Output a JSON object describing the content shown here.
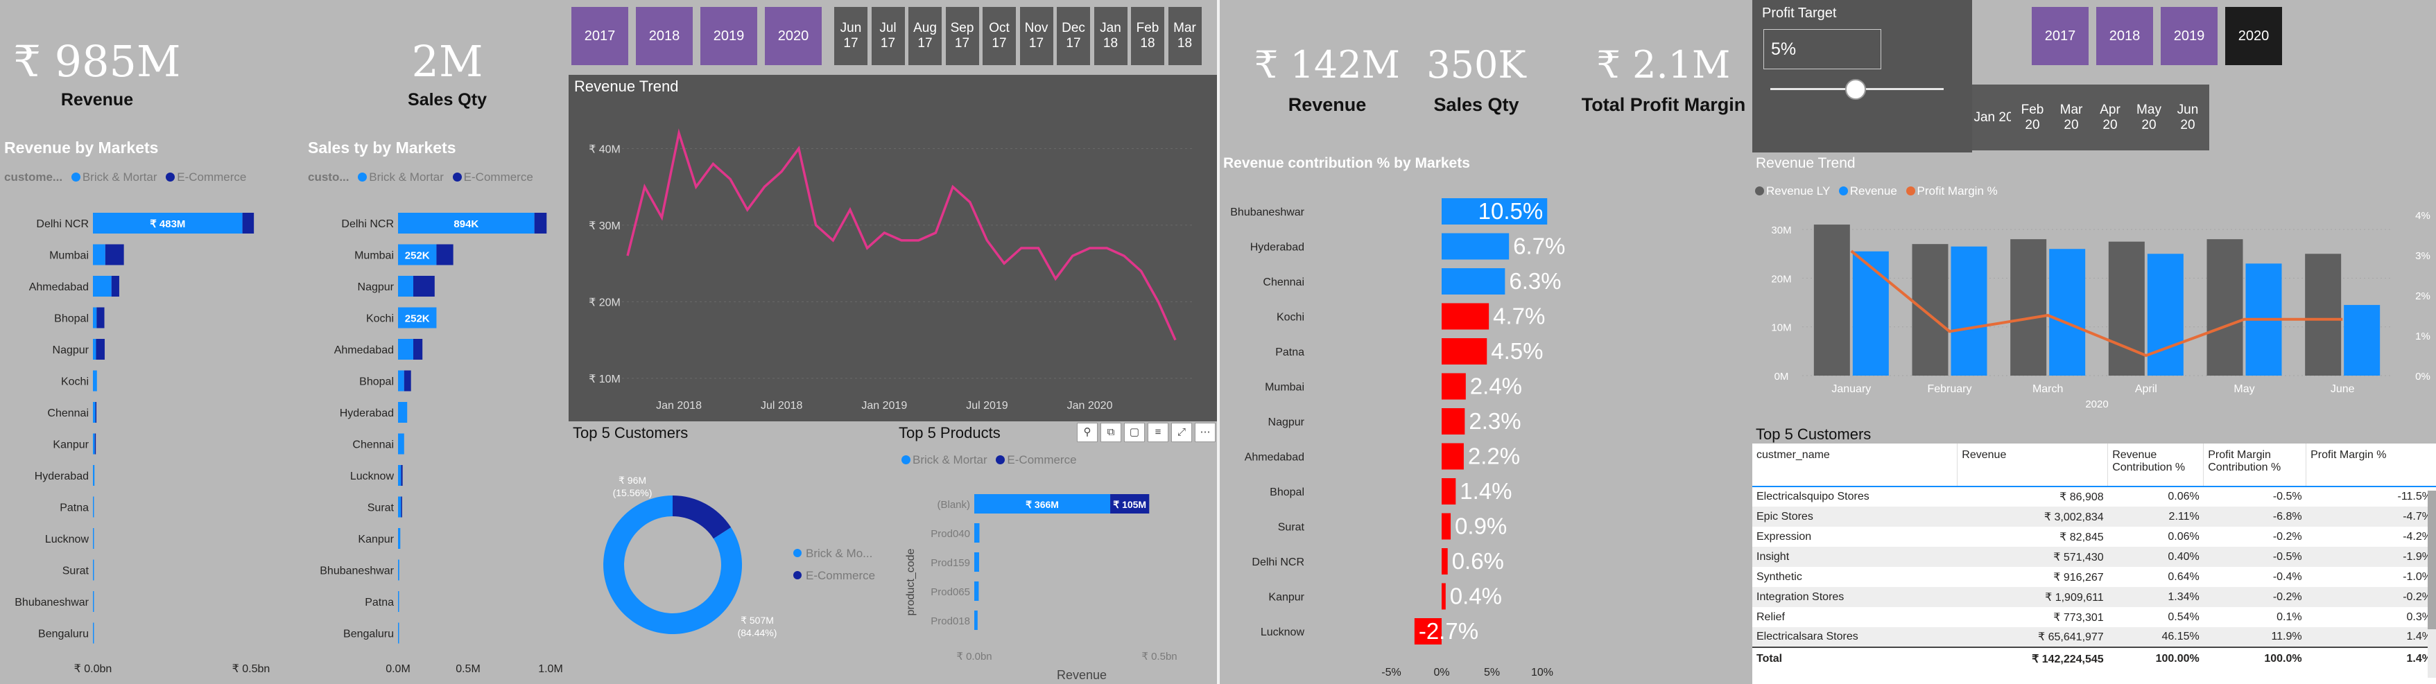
{
  "left": {
    "kpis": [
      {
        "value": "₹ 985M",
        "label": "Revenue"
      },
      {
        "value": "2M",
        "label": "Sales Qty"
      }
    ],
    "revenue_by_markets": {
      "title": "Revenue by Markets",
      "legend_prefix": "custome...",
      "legend_brick": "Brick & Mortar",
      "legend_ecom": "E-Commerce",
      "axis_ticks": [
        "₹ 0.0bn",
        "₹ 0.5bn"
      ]
    },
    "sales_by_markets": {
      "title": "Sales ty by Markets",
      "legend_prefix": "custo...",
      "legend_brick": "Brick & Mortar",
      "legend_ecom": "E-Commerce",
      "axis_ticks": [
        "0.0M",
        "0.5M",
        "1.0M"
      ]
    },
    "years": [
      "2017",
      "2018",
      "2019",
      "2020"
    ],
    "months": [
      "Jun\n17",
      "Jul\n17",
      "Aug\n17",
      "Sep\n17",
      "Oct\n17",
      "Nov\n17",
      "Dec\n17",
      "Jan\n18",
      "Feb\n18",
      "Mar\n18"
    ],
    "revenue_trend_title": "Revenue Trend",
    "top5_customers_title": "Top 5 Customers",
    "top5_products_title": "Top 5 Products",
    "donut": {
      "label_small_value": "₹ 96M",
      "label_small_pct": "(15.56%)",
      "label_big_value": "₹ 507M",
      "label_big_pct": "(84.44%)",
      "legend_brick": "Brick & Mo...",
      "legend_ecom": "E-Commerce"
    },
    "products": {
      "legend_brick": "Brick & Mortar",
      "legend_ecom": "E-Commerce",
      "y_axis_label": "product_code",
      "x_axis_label": "Revenue",
      "x_ticks": [
        "₹ 0.0bn",
        "₹ 0.5bn"
      ]
    }
  },
  "right": {
    "kpis": [
      {
        "value": "₹ 142M",
        "label": "Revenue"
      },
      {
        "value": "350K",
        "label": "Sales Qty"
      },
      {
        "value": "₹ 2.1M",
        "label": "Total Profit Margin"
      }
    ],
    "contrib_title": "Revenue contribution % by Markets",
    "profit_target": {
      "label": "Profit Target",
      "value": "5%",
      "slider_fraction": 0.49
    },
    "years": [
      "2017",
      "2018",
      "2019",
      "2020"
    ],
    "selected_year": "2020",
    "months": [
      "Jan 20",
      "Feb\n20",
      "Mar\n20",
      "Apr\n20",
      "May\n20",
      "Jun\n20"
    ],
    "trend_title": "Revenue Trend",
    "trend_legend": [
      "Revenue LY",
      "Revenue",
      "Profit Margin %"
    ],
    "top5_title": "Top 5 Customers",
    "table": {
      "headers": [
        "custmer_name",
        "Revenue",
        "Revenue Contribution %",
        "Profit Margin Contribution %",
        "Profit Margin %"
      ],
      "rows": [
        [
          "Electricalsquipo Stores",
          "₹ 86,908",
          "0.06%",
          "-0.5%",
          "-11.5%"
        ],
        [
          "Epic Stores",
          "₹ 3,002,834",
          "2.11%",
          "-6.8%",
          "-4.7%"
        ],
        [
          "Expression",
          "₹ 82,845",
          "0.06%",
          "-0.2%",
          "-4.2%"
        ],
        [
          "Insight",
          "₹ 571,430",
          "0.40%",
          "-0.5%",
          "-1.9%"
        ],
        [
          "Synthetic",
          "₹ 916,267",
          "0.64%",
          "-0.4%",
          "-1.0%"
        ],
        [
          "Integration Stores",
          "₹ 1,909,611",
          "1.34%",
          "-0.2%",
          "-0.2%"
        ],
        [
          "Relief",
          "₹ 773,301",
          "0.54%",
          "0.1%",
          "0.3%"
        ],
        [
          "Electricalsara Stores",
          "₹ 65,641,977",
          "46.15%",
          "11.9%",
          "1.4%"
        ]
      ],
      "total": [
        "Total",
        "₹ 142,224,545",
        "100.00%",
        "100.0%",
        "1.4%"
      ]
    }
  },
  "colors": {
    "brick": "#118dff",
    "ecom": "#12239e",
    "pink": "#e0368b",
    "purple": "#7b5aa3",
    "red": "#ff0000",
    "grey_bar": "#5f5f5f",
    "orange": "#e66c37"
  },
  "chart_data": [
    {
      "type": "bar",
      "title": "Revenue by Markets",
      "orientation": "horizontal",
      "stacked": true,
      "categories": [
        "Delhi NCR",
        "Mumbai",
        "Ahmedabad",
        "Bhopal",
        "Nagpur",
        "Kochi",
        "Chennai",
        "Kanpur",
        "Hyderabad",
        "Patna",
        "Lucknow",
        "Surat",
        "Bhubaneshwar",
        "Bengaluru"
      ],
      "series": [
        {
          "name": "Brick & Mortar",
          "values": [
            483,
            40,
            60,
            12,
            10,
            13,
            8,
            6,
            5,
            3,
            2,
            2,
            0.5,
            0.2
          ]
        },
        {
          "name": "E-Commerce",
          "values": [
            37,
            60,
            25,
            25,
            28,
            0,
            3,
            2,
            0,
            0,
            0,
            0,
            0,
            0
          ]
        }
      ],
      "data_labels": [
        "₹ 483M"
      ],
      "xlim": [
        0,
        560
      ],
      "x_ticks": [
        "₹ 0.0bn",
        "₹ 0.5bn"
      ]
    },
    {
      "type": "bar",
      "title": "Sales ty by Markets",
      "orientation": "horizontal",
      "stacked": true,
      "categories": [
        "Delhi NCR",
        "Mumbai",
        "Nagpur",
        "Kochi",
        "Ahmedabad",
        "Bhopal",
        "Hyderabad",
        "Chennai",
        "Lucknow",
        "Surat",
        "Kanpur",
        "Bhubaneshwar",
        "Patna",
        "Bengaluru"
      ],
      "series": [
        {
          "name": "Brick & Mortar",
          "values": [
            894,
            252,
            100,
            252,
            100,
            40,
            60,
            40,
            20,
            20,
            15,
            8,
            5,
            2
          ]
        },
        {
          "name": "E-Commerce",
          "values": [
            80,
            110,
            140,
            0,
            60,
            45,
            0,
            0,
            10,
            5,
            0,
            0,
            0,
            0
          ]
        }
      ],
      "data_labels": [
        "894K",
        "252K",
        "252K"
      ],
      "xlim": [
        0,
        1000
      ],
      "x_ticks": [
        "0.0M",
        "0.5M",
        "1.0M"
      ]
    },
    {
      "type": "line",
      "title": "Revenue Trend",
      "x_ticks": [
        "Jan 2018",
        "Jul 2018",
        "Jan 2019",
        "Jul 2019",
        "Jan 2020"
      ],
      "y_ticks": [
        "₹ 10M",
        "₹ 20M",
        "₹ 30M",
        "₹ 40M"
      ],
      "ylim": [
        8,
        46
      ],
      "x_start": "2017-10",
      "values": [
        26,
        35,
        31,
        42,
        35,
        38,
        36,
        32,
        35,
        37,
        40,
        30,
        28,
        32,
        27,
        29,
        28,
        28,
        29,
        35,
        33,
        28,
        25,
        27,
        27,
        23,
        26,
        27,
        27,
        26,
        24,
        20,
        15
      ]
    },
    {
      "type": "pie",
      "title": "Top 5 Customers",
      "donut": true,
      "slices": [
        {
          "name": "Brick & Mortar",
          "value": 507,
          "pct": 84.44
        },
        {
          "name": "E-Commerce",
          "value": 96,
          "pct": 15.56
        }
      ]
    },
    {
      "type": "bar",
      "title": "Top 5 Products",
      "orientation": "horizontal",
      "stacked": true,
      "categories": [
        "(Blank)",
        "Prod040",
        "Prod159",
        "Prod065",
        "Prod018"
      ],
      "series": [
        {
          "name": "Brick & Mortar",
          "values": [
            366,
            14,
            13,
            12,
            9
          ]
        },
        {
          "name": "E-Commerce",
          "values": [
            105,
            0,
            0,
            0,
            0
          ]
        }
      ],
      "data_labels": [
        "₹ 366M",
        "₹ 105M"
      ],
      "xlim": [
        0,
        560
      ],
      "x_ticks": [
        "₹ 0.0bn",
        "₹ 0.5bn"
      ]
    },
    {
      "type": "bar",
      "title": "Revenue contribution % by Markets",
      "orientation": "horizontal",
      "categories": [
        "Bhubaneshwar",
        "Hyderabad",
        "Chennai",
        "Kochi",
        "Patna",
        "Mumbai",
        "Nagpur",
        "Ahmedabad",
        "Bhopal",
        "Surat",
        "Delhi NCR",
        "Kanpur",
        "Lucknow"
      ],
      "values": [
        10.5,
        6.7,
        6.3,
        4.7,
        4.5,
        2.4,
        2.3,
        2.2,
        1.4,
        0.9,
        0.6,
        0.4,
        -2.7
      ],
      "labels": [
        "10.5%",
        "6.7%",
        "6.3%",
        "4.7%",
        "4.5%",
        "2.4%",
        "2.3%",
        "2.2%",
        "1.4%",
        "0.9%",
        "0.6%",
        "0.4%",
        "-2.7%"
      ],
      "highlight_above": 5,
      "xlim": [
        -5,
        11
      ],
      "x_ticks": [
        "-5%",
        "0%",
        "5%",
        "10%"
      ]
    },
    {
      "type": "bar",
      "title": "Revenue Trend",
      "categories": [
        "January",
        "February",
        "March",
        "April",
        "May",
        "June"
      ],
      "x_group_label": "2020",
      "series": [
        {
          "name": "Revenue LY",
          "values": [
            31,
            27,
            28,
            27.5,
            28,
            25
          ]
        },
        {
          "name": "Revenue",
          "values": [
            25.5,
            26.5,
            26,
            25,
            23,
            14.5
          ]
        },
        {
          "name": "Profit Margin %",
          "type": "line",
          "axis": "right",
          "values": [
            3.1,
            1.1,
            1.5,
            0.5,
            1.4,
            1.4
          ]
        }
      ],
      "y_ticks": [
        "0M",
        "10M",
        "20M",
        "30M"
      ],
      "ylim": [
        0,
        33
      ],
      "y2_ticks": [
        "0%",
        "1%",
        "2%",
        "3%",
        "4%"
      ],
      "y2lim": [
        0,
        4
      ]
    }
  ]
}
